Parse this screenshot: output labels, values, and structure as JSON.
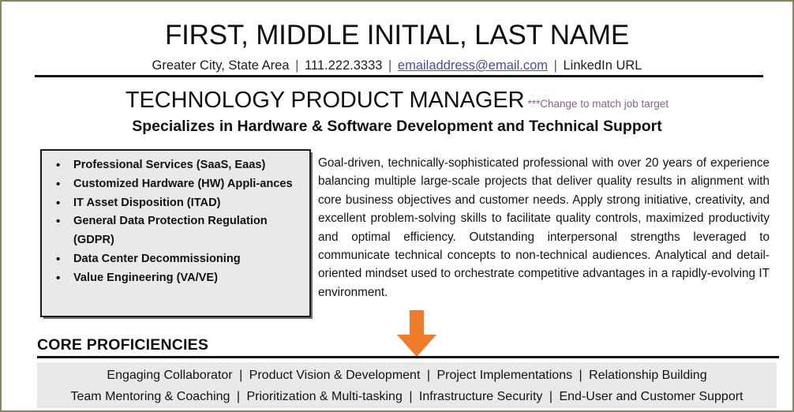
{
  "document": {
    "type": "resume",
    "page_border_color": "#8a8560"
  },
  "header": {
    "name": "FIRST, MIDDLE INITIAL, LAST NAME",
    "contact": {
      "location": "Greater City, State Area",
      "phone": "111.222.3333",
      "email": "emailaddress@email.com",
      "linkedin": "LinkedIn URL",
      "separator": "|"
    }
  },
  "target": {
    "title": "TECHNOLOGY PRODUCT MANAGER",
    "annotation": "***Change to match job target",
    "annotation_color": "#8a5fa0",
    "specialization": "Specializes in Hardware & Software Development and Technical Support"
  },
  "highlights": {
    "items": [
      "Professional Services (SaaS, Eaas)",
      "Customized Hardware (HW) Appli-ances",
      "IT Asset Disposition (ITAD)",
      "General Data Protection Regulation (GDPR)",
      "Data Center Decommissioning",
      "Value Engineering (VA/VE)"
    ],
    "background_color": "#e9e9e9",
    "border_color": "#1a1a1a"
  },
  "summary": {
    "text": "Goal-driven, technically-sophisticated professional with over 20 years of experience balancing multiple large-scale projects that deliver quality results in alignment with core business objectives and customer needs.  Apply strong initiative, creativity, and excellent problem-solving skills to facilitate quality controls, maximized productivity and optimal efficiency. Outstanding interpersonal strengths leveraged to communicate technical concepts to non-technical audiences.  Analytical and detail-oriented mindset used to orchestrate competitive advantages in a rapidly-evolving IT environment."
  },
  "arrow": {
    "direction": "down",
    "color": "#f07b28"
  },
  "core_proficiencies": {
    "heading": "CORE PROFICIENCIES",
    "background_color": "#e9e9e9",
    "separator": "|",
    "rows": [
      [
        "Engaging Collaborator",
        "Product Vision & Development",
        "Project Implementations",
        "Relationship Building"
      ],
      [
        "Team Mentoring & Coaching",
        "Prioritization & Multi-tasking",
        "Infrastructure Security",
        "End-User and Customer Support"
      ]
    ]
  }
}
